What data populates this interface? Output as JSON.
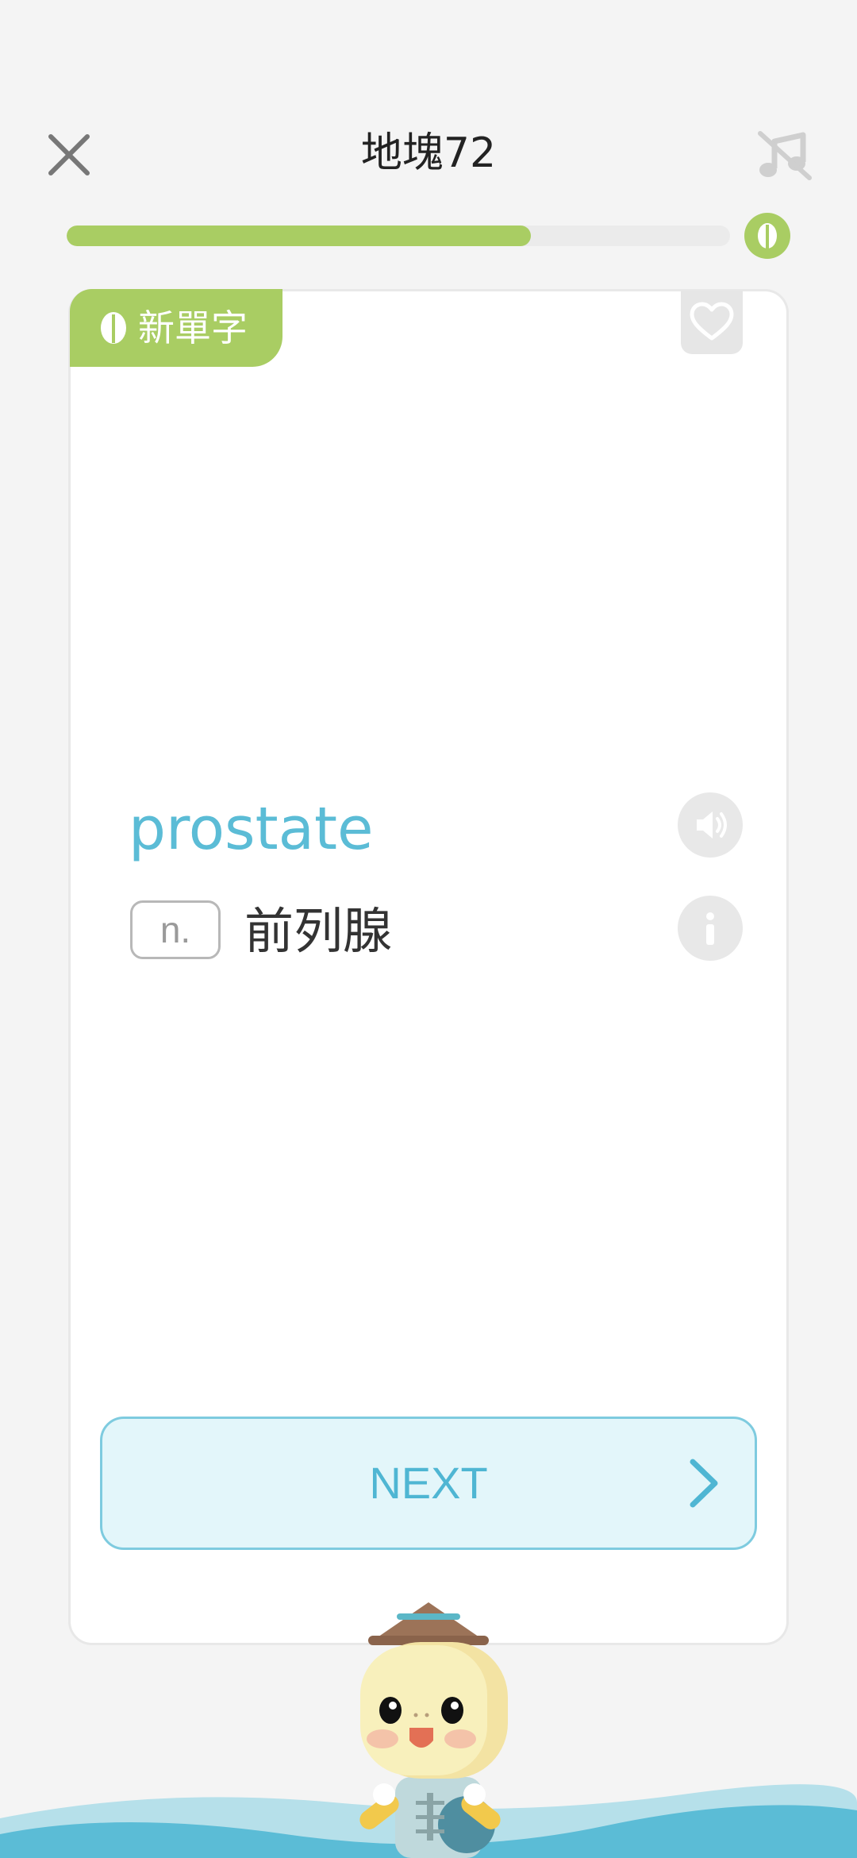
{
  "header": {
    "title": "地塊72",
    "close_icon": "close-icon",
    "music_icon": "music-off-icon"
  },
  "progress": {
    "fraction": 0.7,
    "badge_icon": "leaf-icon"
  },
  "card": {
    "tag_label": "新單字",
    "tag_icon": "leaf-icon",
    "favorite_icon": "heart-icon",
    "word": "prostate",
    "part_of_speech": "n.",
    "meaning": "前列腺",
    "sound_icon": "speaker-icon",
    "info_icon": "info-icon"
  },
  "next_button": {
    "label": "NEXT",
    "icon": "chevron-right-icon"
  },
  "colors": {
    "accent_green": "#a9cd63",
    "accent_blue": "#5bbcd6",
    "button_bg": "#e3f6fa",
    "background": "#f4f4f4"
  }
}
